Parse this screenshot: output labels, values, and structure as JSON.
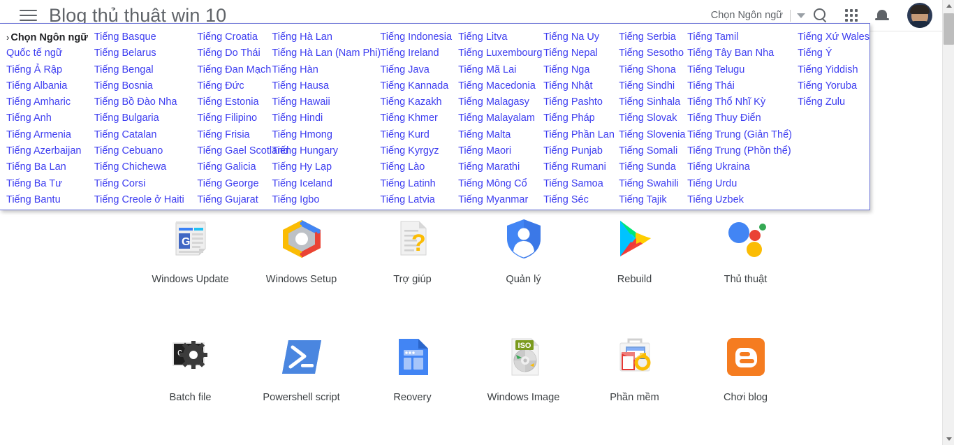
{
  "header": {
    "menu_icon": "hamburger-icon",
    "title": "Blog thủ thuật win 10",
    "language_selector_label": "Chọn Ngôn ngữ",
    "search_icon": "search-icon",
    "apps_icon": "apps-grid-icon",
    "notifications_icon": "bell-icon",
    "avatar": "user-avatar"
  },
  "language_panel": {
    "columns": [
      [
        {
          "label": "Chọn Ngôn ngữ",
          "current": true
        },
        {
          "label": "Quốc tế ngữ"
        },
        {
          "label": "Tiếng Ả Rập"
        },
        {
          "label": "Tiếng Albania"
        },
        {
          "label": "Tiếng Amharic"
        },
        {
          "label": "Tiếng Anh"
        },
        {
          "label": "Tiếng Armenia"
        },
        {
          "label": "Tiếng Azerbaijan"
        },
        {
          "label": "Tiếng Ba Lan"
        },
        {
          "label": "Tiếng Ba Tư"
        },
        {
          "label": "Tiếng Bantu"
        }
      ],
      [
        {
          "label": "Tiếng Basque"
        },
        {
          "label": "Tiếng Belarus"
        },
        {
          "label": "Tiếng Bengal"
        },
        {
          "label": "Tiếng Bosnia"
        },
        {
          "label": "Tiếng Bồ Đào Nha"
        },
        {
          "label": "Tiếng Bulgaria"
        },
        {
          "label": "Tiếng Catalan"
        },
        {
          "label": "Tiếng Cebuano"
        },
        {
          "label": "Tiếng Chichewa"
        },
        {
          "label": "Tiếng Corsi"
        },
        {
          "label": "Tiếng Creole ở Haiti"
        }
      ],
      [
        {
          "label": "Tiếng Croatia"
        },
        {
          "label": "Tiếng Do Thái"
        },
        {
          "label": "Tiếng Đan Mạch"
        },
        {
          "label": "Tiếng Đức"
        },
        {
          "label": "Tiếng Estonia"
        },
        {
          "label": "Tiếng Filipino"
        },
        {
          "label": "Tiếng Frisia"
        },
        {
          "label": "Tiếng Gael Scotland"
        },
        {
          "label": "Tiếng Galicia"
        },
        {
          "label": "Tiếng George"
        },
        {
          "label": "Tiếng Gujarat"
        }
      ],
      [
        {
          "label": "Tiếng Hà Lan"
        },
        {
          "label": "Tiếng Hà Lan (Nam Phi)"
        },
        {
          "label": "Tiếng Hàn"
        },
        {
          "label": "Tiếng Hausa"
        },
        {
          "label": "Tiếng Hawaii"
        },
        {
          "label": "Tiếng Hindi"
        },
        {
          "label": "Tiếng Hmong"
        },
        {
          "label": "Tiếng Hungary"
        },
        {
          "label": "Tiếng Hy Lạp"
        },
        {
          "label": "Tiếng Iceland"
        },
        {
          "label": "Tiếng Igbo"
        }
      ],
      [
        {
          "label": "Tiếng Indonesia"
        },
        {
          "label": "Tiếng Ireland"
        },
        {
          "label": "Tiếng Java"
        },
        {
          "label": "Tiếng Kannada"
        },
        {
          "label": "Tiếng Kazakh"
        },
        {
          "label": "Tiếng Khmer"
        },
        {
          "label": "Tiếng Kurd"
        },
        {
          "label": "Tiếng Kyrgyz"
        },
        {
          "label": "Tiếng Lào"
        },
        {
          "label": "Tiếng Latinh"
        },
        {
          "label": "Tiếng Latvia"
        }
      ],
      [
        {
          "label": "Tiếng Litva"
        },
        {
          "label": "Tiếng Luxembourg"
        },
        {
          "label": "Tiếng Mã Lai"
        },
        {
          "label": "Tiếng Macedonia"
        },
        {
          "label": "Tiếng Malagasy"
        },
        {
          "label": "Tiếng Malayalam"
        },
        {
          "label": "Tiếng Malta"
        },
        {
          "label": "Tiếng Maori"
        },
        {
          "label": "Tiếng Marathi"
        },
        {
          "label": "Tiếng Mông Cổ"
        },
        {
          "label": "Tiếng Myanmar"
        }
      ],
      [
        {
          "label": "Tiếng Na Uy"
        },
        {
          "label": "Tiếng Nepal"
        },
        {
          "label": "Tiếng Nga"
        },
        {
          "label": "Tiếng Nhật"
        },
        {
          "label": "Tiếng Pashto"
        },
        {
          "label": "Tiếng Pháp"
        },
        {
          "label": "Tiếng Phần Lan"
        },
        {
          "label": "Tiếng Punjab"
        },
        {
          "label": "Tiếng Rumani"
        },
        {
          "label": "Tiếng Samoa"
        },
        {
          "label": "Tiếng Séc"
        }
      ],
      [
        {
          "label": "Tiếng Serbia"
        },
        {
          "label": "Tiếng Sesotho"
        },
        {
          "label": "Tiếng Shona"
        },
        {
          "label": "Tiếng Sindhi"
        },
        {
          "label": "Tiếng Sinhala"
        },
        {
          "label": "Tiếng Slovak"
        },
        {
          "label": "Tiếng Slovenia"
        },
        {
          "label": "Tiếng Somali"
        },
        {
          "label": "Tiếng Sunda"
        },
        {
          "label": "Tiếng Swahili"
        },
        {
          "label": "Tiếng Tajik"
        }
      ],
      [
        {
          "label": "Tiếng Tamil"
        },
        {
          "label": "Tiếng Tây Ban Nha"
        },
        {
          "label": "Tiếng Telugu"
        },
        {
          "label": "Tiếng Thái"
        },
        {
          "label": "Tiếng Thổ Nhĩ Kỳ"
        },
        {
          "label": "Tiếng Thuy Điển"
        },
        {
          "label": "Tiếng Trung (Giản Thể)"
        },
        {
          "label": "Tiếng Trung (Phồn thể)"
        },
        {
          "label": "Tiếng Ukraina"
        },
        {
          "label": "Tiếng Urdu"
        },
        {
          "label": "Tiếng Uzbek"
        }
      ],
      [
        {
          "label": "Tiếng Xứ Wales"
        },
        {
          "label": "Tiếng Ý"
        },
        {
          "label": "Tiếng Yiddish"
        },
        {
          "label": "Tiếng Yoruba"
        },
        {
          "label": "Tiếng Zulu"
        }
      ]
    ]
  },
  "shortcuts": {
    "row1": [
      {
        "label": "Windows Update",
        "icon": "google-news-document-icon"
      },
      {
        "label": "Windows Setup",
        "icon": "google-cloud-hexagon-icon"
      },
      {
        "label": "Trợ giúp",
        "icon": "document-question-mark-icon"
      },
      {
        "label": "Quản lý",
        "icon": "account-shield-icon"
      },
      {
        "label": "Rebuild",
        "icon": "google-play-icon"
      },
      {
        "label": "Thủ thuật",
        "icon": "google-assistant-dots-icon"
      }
    ],
    "row2": [
      {
        "label": "Batch file",
        "icon": "command-prompt-gear-icon"
      },
      {
        "label": "Powershell script",
        "icon": "powershell-icon"
      },
      {
        "label": "Reovery",
        "icon": "google-sites-icon"
      },
      {
        "label": "Windows Image",
        "icon": "iso-disc-icon",
        "badge": "ISO"
      },
      {
        "label": "Phần mềm",
        "icon": "toolbox-icon"
      },
      {
        "label": "Chơi blog",
        "icon": "blogger-icon"
      }
    ]
  },
  "scrollbar": {
    "up_arrow": "scroll-up-arrow-icon",
    "down_arrow": "scroll-down-arrow-icon",
    "thumb": "scroll-thumb"
  },
  "colors": {
    "link_blue": "#3d3df0",
    "panel_border": "#6b74d6",
    "title_gray": "#5f6368",
    "label_gray": "#3c4043"
  }
}
